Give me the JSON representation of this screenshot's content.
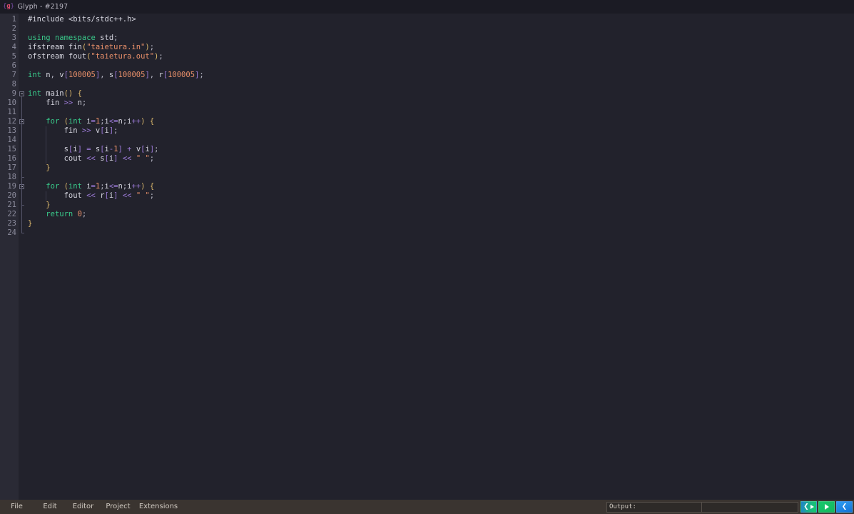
{
  "window": {
    "logo_left_bracket": "{",
    "logo_letter": "g",
    "logo_right_bracket": "}",
    "title": "Glyph - #2197"
  },
  "editor": {
    "language": "cpp",
    "total_lines": 24,
    "line_numbers": [
      1,
      2,
      3,
      4,
      5,
      6,
      7,
      8,
      9,
      10,
      11,
      12,
      13,
      14,
      15,
      16,
      17,
      18,
      19,
      20,
      21,
      22,
      23,
      24
    ],
    "lines": [
      "#include <bits/stdc++.h>",
      "",
      "using namespace std;",
      "ifstream fin(\"taietura.in\");",
      "ofstream fout(\"taietura.out\");",
      "",
      "int n, v[100005], s[100005], r[100005];",
      "",
      "int main() {",
      "    fin >> n;",
      "",
      "    for (int i=1;i<=n;i++) {",
      "        fin >> v[i];",
      "",
      "        s[i] = s[i-1] + v[i];",
      "        cout << s[i] << \" \";",
      "    }",
      "",
      "    for (int i=1;i<=n;i++) {",
      "        fout << r[i] << \" \";",
      "    }",
      "    return 0;",
      "}",
      ""
    ],
    "fold_markers": [
      {
        "line": 9,
        "type": "open"
      },
      {
        "line": 12,
        "type": "open"
      },
      {
        "line": 18,
        "type": "close"
      },
      {
        "line": 19,
        "type": "open"
      },
      {
        "line": 21,
        "type": "close"
      },
      {
        "line": 24,
        "type": "close"
      }
    ],
    "colors": {
      "background": "#22222c",
      "gutter_background": "#2a2a35",
      "gutter_text": "#8b8b9c",
      "foreground": "#d6d6e0",
      "keyword": "#39c98a",
      "string": "#e9906a",
      "number": "#e9906a",
      "bracket_round": "#d7b46a",
      "bracket_square": "#9b7ad6",
      "operator": "#9b7ad6"
    }
  },
  "bottom_bar": {
    "background": "#3a3430",
    "menu": [
      {
        "label": "File"
      },
      {
        "label": "Edit"
      },
      {
        "label": "Editor"
      },
      {
        "label": "Project"
      },
      {
        "label": "Extensions"
      }
    ],
    "output_label": "Output:",
    "output_value": "",
    "buttons": [
      {
        "name": "compile-and-run",
        "icon": "compile-run-icon",
        "accent": "#17c96a"
      },
      {
        "name": "run",
        "icon": "play-icon",
        "accent": "#18c76d"
      },
      {
        "name": "compile",
        "icon": "compile-icon",
        "accent": "#2e9df0"
      }
    ]
  }
}
